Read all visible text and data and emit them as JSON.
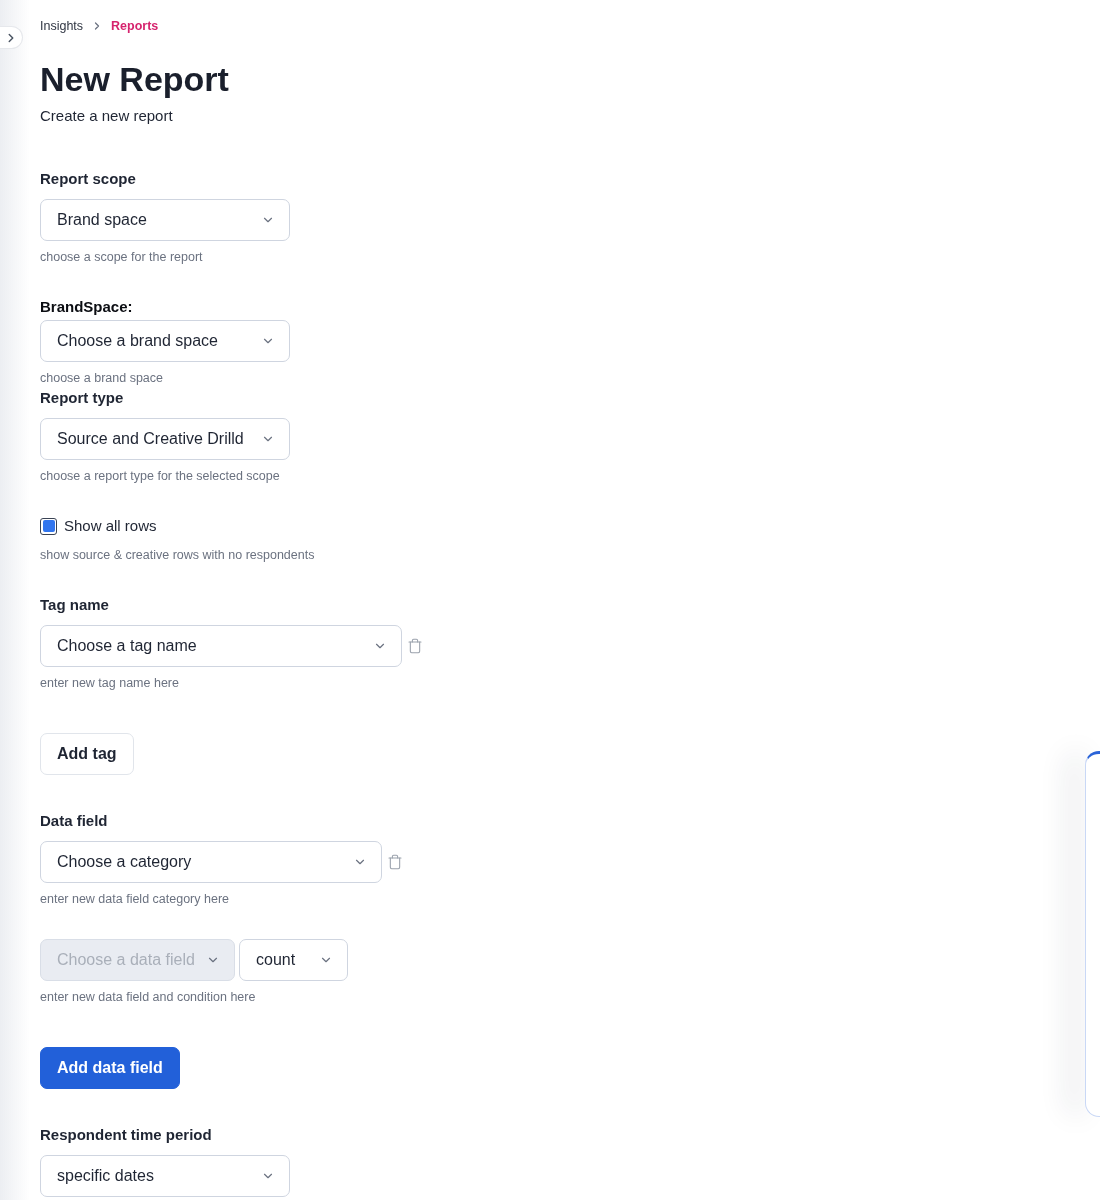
{
  "breadcrumb": [
    {
      "label": "Insights",
      "current": false
    },
    {
      "label": "Reports",
      "current": true
    }
  ],
  "header": {
    "title": "New Report",
    "subtitle": "Create a new report"
  },
  "sections": [
    {
      "kind": "select",
      "fields": [
        {
          "label": "Report scope",
          "strong_label": false,
          "value": "Brand space",
          "hint": "choose a scope for the report",
          "removable": false
        }
      ]
    },
    {
      "kind": "select",
      "fields": [
        {
          "label": "BrandSpace:",
          "strong_label": true,
          "value": "Choose a brand space",
          "hint": "choose a brand space",
          "removable": false
        },
        {
          "label": "Report type",
          "strong_label": false,
          "value": "Source and Creative Drilld",
          "hint": "choose a report type for the selected scope",
          "removable": false
        }
      ]
    },
    {
      "kind": "checkbox",
      "label": "Show all rows",
      "checked": true,
      "hint": "show source & creative rows with no respondents"
    },
    {
      "kind": "select",
      "fields": [
        {
          "label": "Tag name",
          "strong_label": false,
          "value": "Choose a tag name",
          "hint": "enter new tag name here",
          "removable": true
        }
      ]
    },
    {
      "kind": "button",
      "label": "Add tag",
      "primary": false
    },
    {
      "kind": "select",
      "fields": [
        {
          "label": "Data field",
          "strong_label": false,
          "value": "Choose a category",
          "hint": "enter new data field category here",
          "removable": true
        }
      ]
    },
    {
      "kind": "select_row",
      "selects": [
        {
          "value": "Choose a data field",
          "disabled": true
        },
        {
          "value": "count",
          "disabled": false
        }
      ],
      "hint": "enter new data field and condition here"
    },
    {
      "kind": "button",
      "label": "Add data field",
      "primary": true
    },
    {
      "kind": "select",
      "fields": [
        {
          "label": "Respondent time period",
          "strong_label": false,
          "value": "specific dates",
          "removable": false
        }
      ]
    }
  ]
}
